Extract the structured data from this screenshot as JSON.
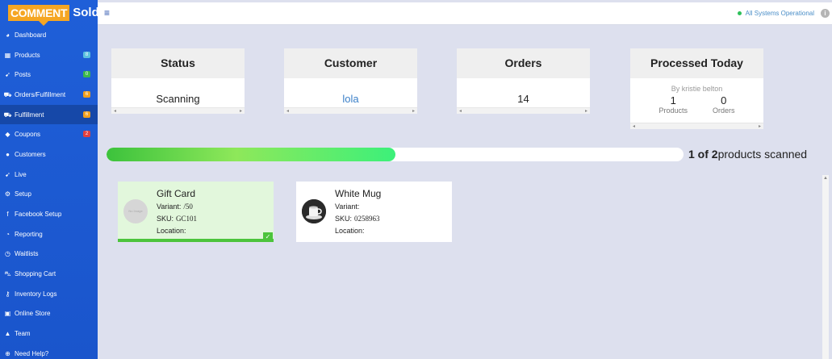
{
  "logo": {
    "part1": "COMMENT",
    "part2": "Sold"
  },
  "sidebar": {
    "items": [
      {
        "label": "Dashboard",
        "icon": "dashboard-icon",
        "glyph": "◕"
      },
      {
        "label": "Products",
        "icon": "grid-icon",
        "glyph": "▦",
        "badge": "8",
        "badge_color": "#5bc0de"
      },
      {
        "label": "Posts",
        "icon": "rss-icon",
        "glyph": "➹",
        "badge": "0",
        "badge_color": "#3cb84c"
      },
      {
        "label": "Orders/Fulfillment",
        "icon": "truck-icon",
        "glyph": "⛟",
        "badge": "6",
        "badge_color": "#f0a020"
      },
      {
        "label": "Fulfillment",
        "icon": "truck-icon",
        "glyph": "⛟",
        "badge": "6",
        "badge_color": "#f0a020",
        "active": true
      },
      {
        "label": "Coupons",
        "icon": "tag-icon",
        "glyph": "◆",
        "badge": "2",
        "badge_color": "#e04040"
      },
      {
        "label": "Customers",
        "icon": "user-icon",
        "glyph": "●"
      },
      {
        "label": "Live",
        "icon": "rss-icon",
        "glyph": "➹"
      },
      {
        "label": "Setup",
        "icon": "gears-icon",
        "glyph": "⚙"
      },
      {
        "label": "Facebook Setup",
        "icon": "facebook-icon",
        "glyph": "f"
      },
      {
        "label": "Reporting",
        "icon": "pie-chart-icon",
        "glyph": "◔"
      },
      {
        "label": "Waitlists",
        "icon": "clock-icon",
        "glyph": "◷"
      },
      {
        "label": "Shopping Cart",
        "icon": "cart-icon",
        "glyph": "⛍"
      },
      {
        "label": "Inventory Logs",
        "icon": "key-icon",
        "glyph": "⚷"
      },
      {
        "label": "Online Store",
        "icon": "shopping-bag-icon",
        "glyph": "▣"
      },
      {
        "label": "Team",
        "icon": "lock-icon",
        "glyph": "▲"
      },
      {
        "label": "Need Help?",
        "icon": "lifebuoy-icon",
        "glyph": "⊕"
      }
    ]
  },
  "topbar": {
    "status": "All Systems Operational",
    "status_color": "#2ec05a"
  },
  "cards": {
    "status": {
      "title": "Status",
      "value": "Scanning"
    },
    "customer": {
      "title": "Customer",
      "value": "lola"
    },
    "orders": {
      "title": "Orders",
      "value": "14"
    },
    "processed": {
      "title": "Processed Today",
      "by": "By kristie belton",
      "products_count": "1",
      "products_label": "Products",
      "orders_count": "0",
      "orders_label": "Orders"
    }
  },
  "progress": {
    "scanned": "1 of 2",
    "suffix": "products scanned",
    "fraction": 0.5
  },
  "products": [
    {
      "name": "Gift Card",
      "variant_label": "Variant:",
      "variant": "/50",
      "sku_label": "SKU:",
      "sku": "GC101",
      "location_label": "Location:",
      "location": "",
      "thumb_text": "No Image",
      "scanned": true,
      "check": "✓"
    },
    {
      "name": "White Mug",
      "variant_label": "Variant:",
      "variant": "",
      "sku_label": "SKU:",
      "sku": "0258963",
      "location_label": "Location:",
      "location": "",
      "scanned": false
    }
  ]
}
